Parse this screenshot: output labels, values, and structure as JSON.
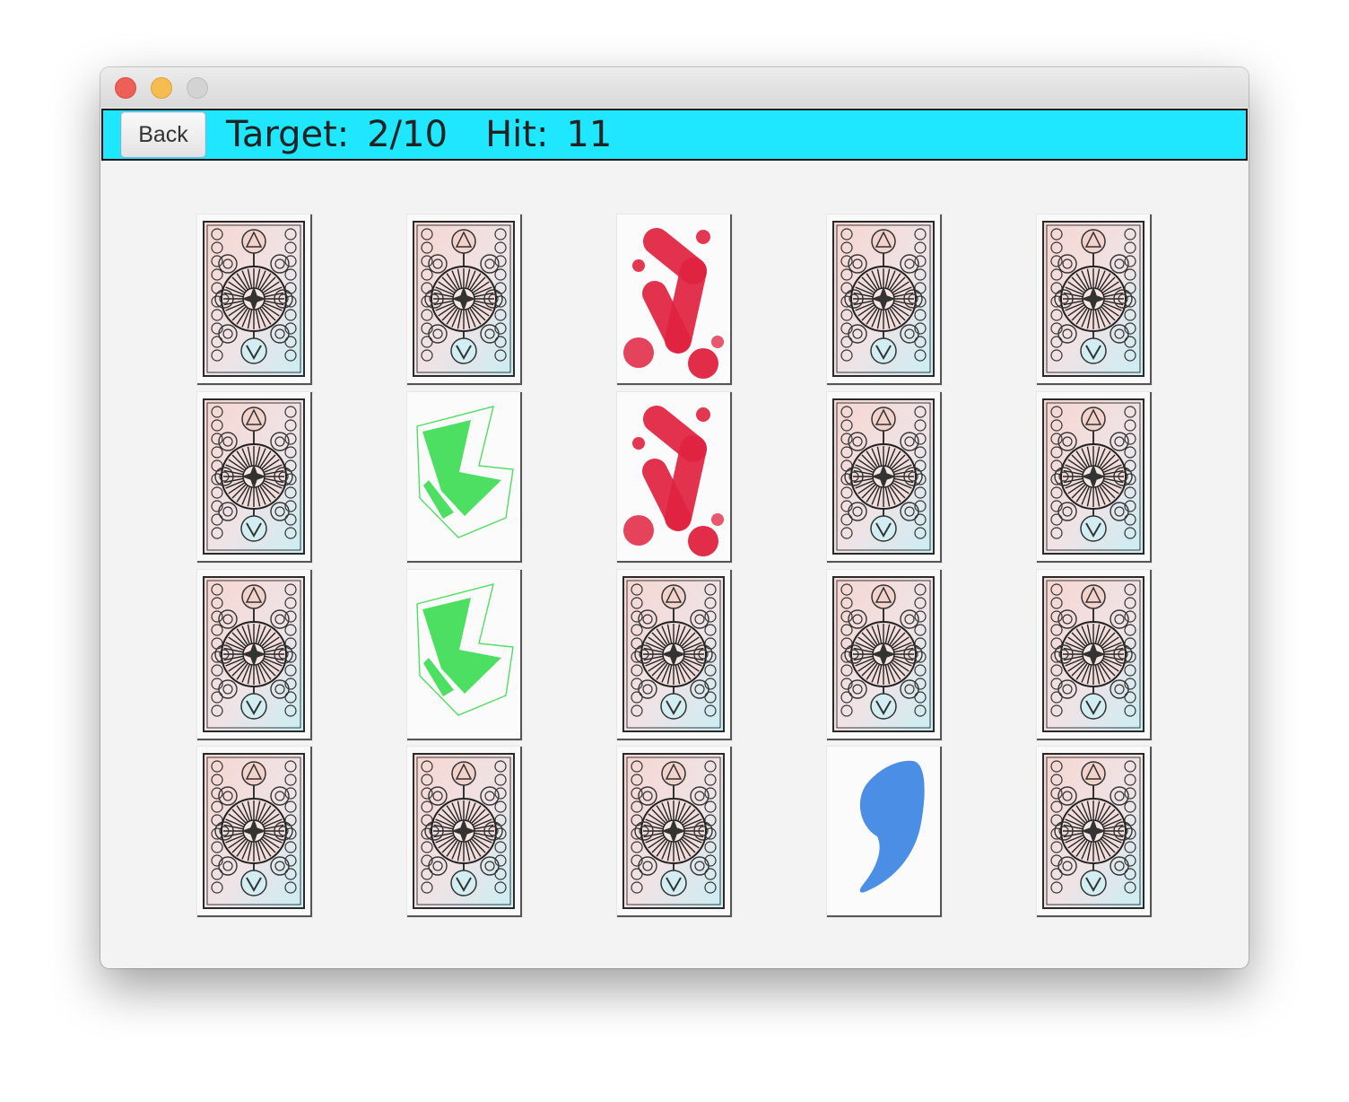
{
  "window": {
    "controls": [
      "close-icon",
      "minimize-icon",
      "zoom-icon"
    ]
  },
  "header": {
    "back_label": "Back",
    "target_label": "Target:",
    "target_value": "2/10",
    "hit_label": "Hit:",
    "hit_value": "11",
    "background": "#1fe7ff"
  },
  "board": {
    "rows": 4,
    "cols": 5,
    "cards": [
      "back",
      "back",
      "red-blot",
      "back",
      "back",
      "back",
      "green-shape",
      "red-blot",
      "back",
      "back",
      "back",
      "green-shape",
      "back",
      "back",
      "back",
      "back",
      "back",
      "back",
      "blue-comma",
      "back"
    ]
  },
  "colors": {
    "red_blot": "#e0223f",
    "green_shape": "#4ddf62",
    "blue_comma": "#4a8ee6"
  }
}
